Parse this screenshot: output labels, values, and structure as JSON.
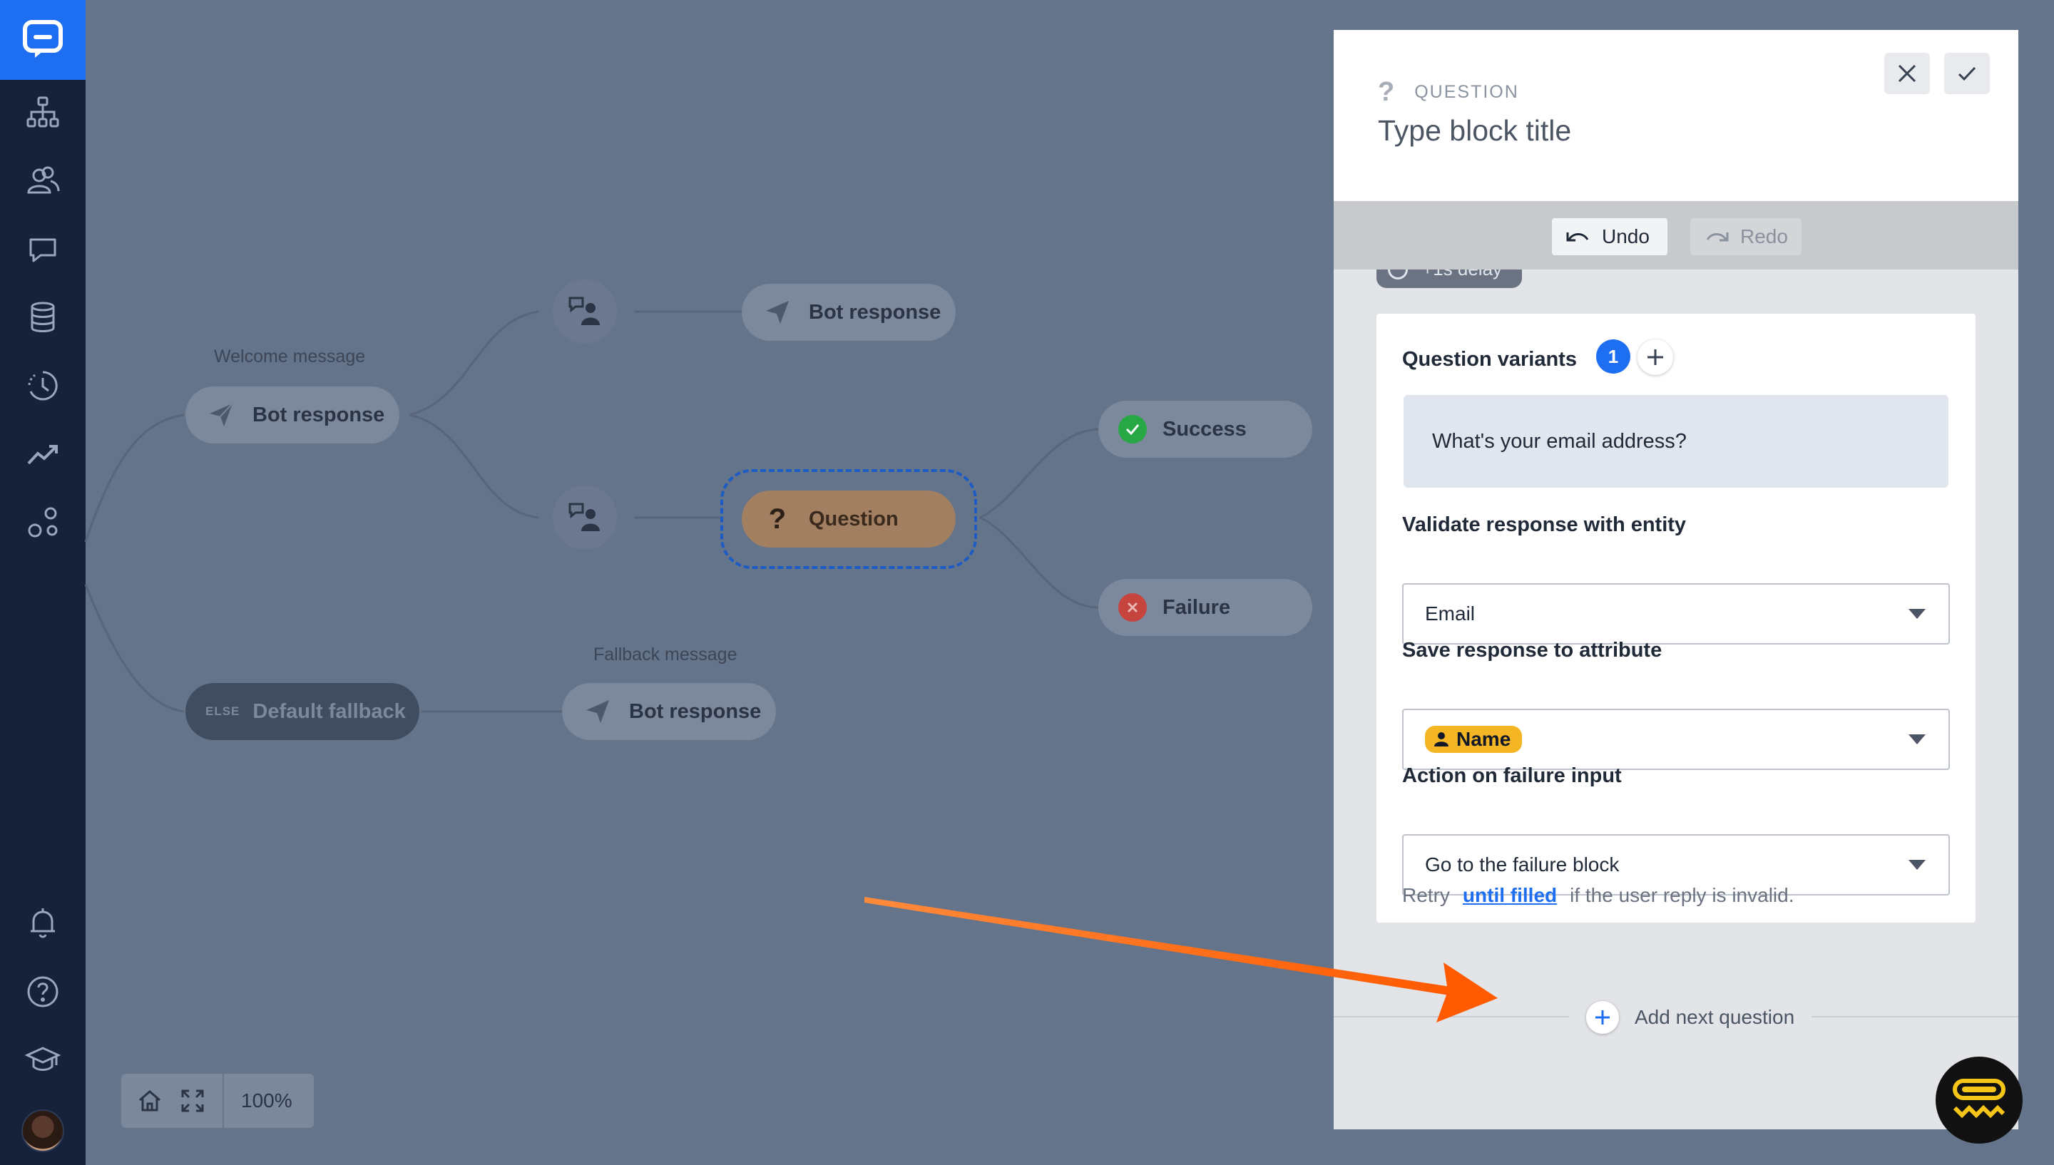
{
  "sidebar": {
    "items": [
      {
        "name": "flows-icon"
      },
      {
        "name": "audience-icon"
      },
      {
        "name": "chat-icon"
      },
      {
        "name": "database-icon"
      },
      {
        "name": "history-icon"
      },
      {
        "name": "reports-icon"
      },
      {
        "name": "integrations-icon"
      },
      {
        "name": "bell-icon"
      },
      {
        "name": "help-icon"
      },
      {
        "name": "academy-icon"
      }
    ]
  },
  "canvas": {
    "welcome_label": "Welcome message",
    "fallback_label": "Fallback message",
    "nodes": {
      "welcome": "Bot response",
      "top_bot": "Bot response",
      "question": "Question",
      "success": "Success",
      "failure": "Failure",
      "default_fallback": "Default fallback",
      "else_tag": "ELSE",
      "fallback_bot": "Bot response"
    },
    "zoom": "100%"
  },
  "panel": {
    "kind": "QUESTION",
    "title_placeholder": "Type block title",
    "undo": "Undo",
    "redo": "Redo",
    "delay": "+1s delay",
    "question_variants_label": "Question variants",
    "variant_count": "1",
    "variant_text": "What's your email address?",
    "validate_label": "Validate response with entity",
    "validate_value": "Email",
    "save_label": "Save response to attribute",
    "save_value": "Name",
    "failure_label": "Action on failure input",
    "failure_value": "Go to the failure block",
    "retry_prefix": "Retry",
    "retry_link": "until filled",
    "retry_suffix": "if the user reply is invalid.",
    "add_next": "Add next question"
  },
  "colors": {
    "sidebar": "#16213a",
    "brand": "#1e6ef2",
    "canvas": "#64748a",
    "arrow": "#ff6a14",
    "attribute_chip": "#f5b625",
    "success": "#27a844",
    "failure": "#d6403a"
  }
}
